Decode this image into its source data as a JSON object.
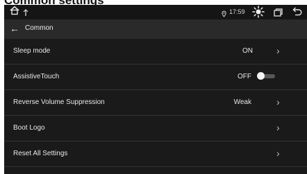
{
  "header_crop_text": "Common settings",
  "status_bar": {
    "time": "17:59",
    "icons": [
      "home-icon",
      "signal-icon",
      "location-icon",
      "brightness-icon",
      "window-icon",
      "return-icon"
    ]
  },
  "title_bar": {
    "title": "Common"
  },
  "settings": [
    {
      "label": "Sleep mode",
      "value": "ON",
      "control": "chevron"
    },
    {
      "label": "AssistiveTouch",
      "value": "OFF",
      "control": "toggle"
    },
    {
      "label": "Reverse Volume Suppression",
      "value": "Weak",
      "control": "chevron"
    },
    {
      "label": "Boot Logo",
      "value": "",
      "control": "chevron"
    },
    {
      "label": "Reset All Settings",
      "value": "",
      "control": "chevron"
    }
  ]
}
